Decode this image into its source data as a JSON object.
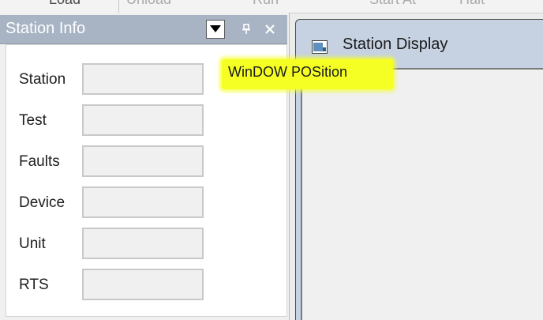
{
  "toolbar": {
    "buttons": [
      {
        "label": "Load",
        "state": "enabled"
      },
      {
        "label": "Unload",
        "state": "disabled"
      },
      {
        "label": "Run",
        "state": "disabled"
      },
      {
        "label": "Start At",
        "state": "disabled"
      },
      {
        "label": "Halt",
        "state": "disabled"
      }
    ]
  },
  "station_info": {
    "title": "Station Info",
    "title_bar_color": "#a8b4c4",
    "icons": [
      "chevron-down-icon",
      "pin-icon",
      "close-icon"
    ],
    "fields": [
      {
        "label": "Station",
        "value": ""
      },
      {
        "label": "Test",
        "value": ""
      },
      {
        "label": "Faults",
        "value": ""
      },
      {
        "label": "Device",
        "value": ""
      },
      {
        "label": "Unit",
        "value": ""
      },
      {
        "label": "RTS",
        "value": ""
      }
    ]
  },
  "tooltip": {
    "text": "WinDOW POSition",
    "color": "#f5ff24"
  },
  "station_display": {
    "title": "Station Display",
    "icon": "app-window-icon"
  }
}
